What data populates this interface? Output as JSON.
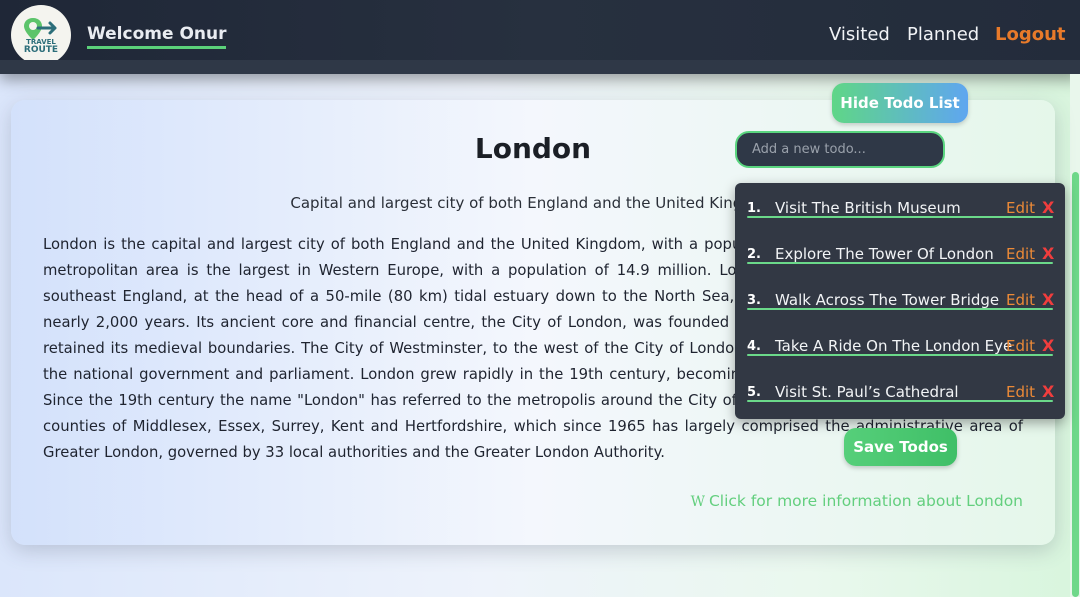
{
  "header": {
    "logo": {
      "line1": "TRAVEL",
      "line2": "ROUTE"
    },
    "welcome_prefix": "Welcome",
    "user_name": "Onur",
    "nav": {
      "visited": "Visited",
      "planned": "Planned",
      "logout": "Logout"
    }
  },
  "city": {
    "title": "London",
    "subtitle": "Capital and largest city of both England and the United Kingdom",
    "description": "London is the capital and largest city of both England and the United Kingdom, with a population of 8,866,180 in 2022. Its wider metropolitan area is the largest in Western Europe, with a population of 14.9 million. London stands on the River Thames in southeast England, at the head of a 50-mile (80 km) tidal estuary down to the North Sea, and has been a major settlement for nearly 2,000 years. Its ancient core and financial centre, the City of London, was founded by the Romans as Londinium and has retained its medieval boundaries. The City of Westminster, to the west of the City of London, has been the centuries-long host of the national government and parliament. London grew rapidly in the 19th century, becoming the world's largest city at the time. Since the 19th century the name \"London\" has referred to the metropolis around the City of London, historically split between the counties of Middlesex, Essex, Surrey, Kent and Hertfordshire, which since 1965 has largely comprised the administrative area of Greater London, governed by 33 local authorities and the Greater London Authority.",
    "wiki_icon": "W",
    "wiki_link": "Click for more information about London"
  },
  "todo": {
    "hide_label": "Hide Todo List",
    "input_placeholder": "Add a new todo...",
    "items": [
      {
        "num": "1.",
        "text": "Visit The British Museum",
        "edit": "Edit",
        "del": "X"
      },
      {
        "num": "2.",
        "text": "Explore The Tower Of London",
        "edit": "Edit",
        "del": "X"
      },
      {
        "num": "3.",
        "text": "Walk Across The Tower Bridge",
        "edit": "Edit",
        "del": "X"
      },
      {
        "num": "4.",
        "text": "Take A Ride On The London Eye",
        "edit": "Edit",
        "del": "X"
      },
      {
        "num": "5.",
        "text": "Visit St. Paul’s Cathedral",
        "edit": "Edit",
        "del": "X"
      }
    ],
    "save_label": "Save Todos"
  },
  "colors": {
    "accent_green": "#5bd17a",
    "logout_orange": "#e87a2a",
    "delete_red": "#f03d3d",
    "header_bg": "#1f2737"
  }
}
